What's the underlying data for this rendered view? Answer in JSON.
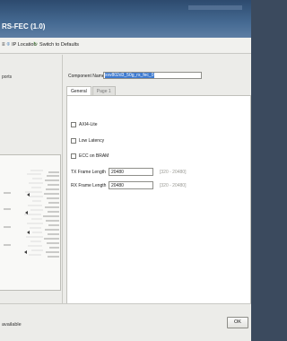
{
  "window": {
    "title": "RS-FEC (1.0)"
  },
  "toolbar": {
    "ip_location": "IP Location",
    "switch_defaults": "Switch to Defaults"
  },
  "left": {
    "ports_label": "ports"
  },
  "main": {
    "component_name_label": "Component Name",
    "component_name_value": "xxv802d3_50g_rs_fec_0",
    "tabs": [
      {
        "label": "General"
      },
      {
        "label": "Page 1"
      }
    ],
    "checkboxes": [
      {
        "label": "AXI4-Lite"
      },
      {
        "label": "Low Latency"
      },
      {
        "label": "ECC on BRAM"
      }
    ],
    "fields": [
      {
        "label": "TX Frame Length",
        "value": "20480",
        "range": "[320 - 20480]"
      },
      {
        "label": "RX Frame Length",
        "value": "20480",
        "range": "[320 - 20480]"
      }
    ]
  },
  "footer": {
    "status_text": "available",
    "ok_label": "OK"
  },
  "colors": {
    "titlebar": "#2d4a6e",
    "selection": "#3d7ad0"
  }
}
